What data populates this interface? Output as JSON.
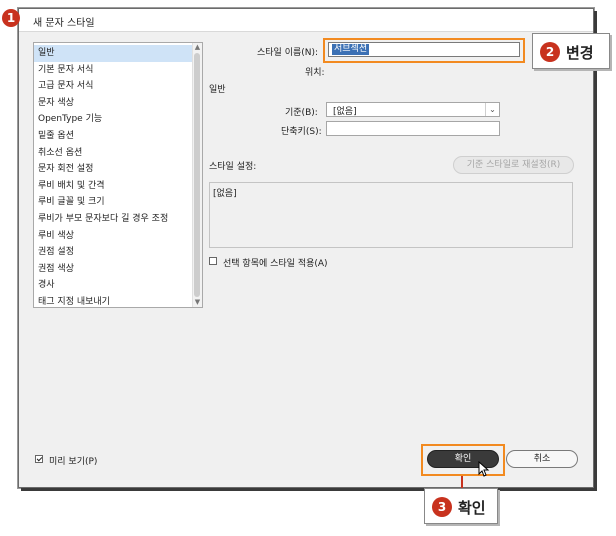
{
  "window": {
    "title": "새 문자 스타일"
  },
  "sidebar": {
    "items": [
      {
        "label": "일반"
      },
      {
        "label": "기본 문자 서식"
      },
      {
        "label": "고급 문자 서식"
      },
      {
        "label": "문자 색상"
      },
      {
        "label": "OpenType 기능"
      },
      {
        "label": "밑줄 옵션"
      },
      {
        "label": "취소선 옵션"
      },
      {
        "label": "문자 회전 설정"
      },
      {
        "label": "루비 배치 및 간격"
      },
      {
        "label": "루비 글꼴 및 크기"
      },
      {
        "label": "루비가 부모 문자보다 길 경우 조정"
      },
      {
        "label": "루비 색상"
      },
      {
        "label": "권점 설정"
      },
      {
        "label": "권점 색상"
      },
      {
        "label": "경사"
      },
      {
        "label": "태그 지정 내보내기"
      }
    ],
    "selected": "일반"
  },
  "form": {
    "style_name_label": "스타일 이름(N):",
    "style_name_value": "서브섹션",
    "location_label": "위치:",
    "section_title": "일반",
    "based_on_label": "기준(B):",
    "based_on_value": "[없음]",
    "shortcut_label": "단축키(S):",
    "shortcut_value": "",
    "settings_label": "스타일 설정:",
    "reset_button_label": "기준 스타일로 재설정(R)",
    "settings_text": "[없음]",
    "apply_checkbox_label": "선택 항목에 스타일 적용(A)",
    "apply_checked": false
  },
  "footer": {
    "preview_label": "미리 보기(P)",
    "preview_checked": true,
    "ok_label": "확인",
    "cancel_label": "취소"
  },
  "annotations": {
    "step1_number": "1",
    "step2_number": "2",
    "step2_text": "변경",
    "step3_number": "3",
    "step3_text": "확인",
    "accent_color": "#f28a20",
    "badge_color": "#c8321e"
  }
}
